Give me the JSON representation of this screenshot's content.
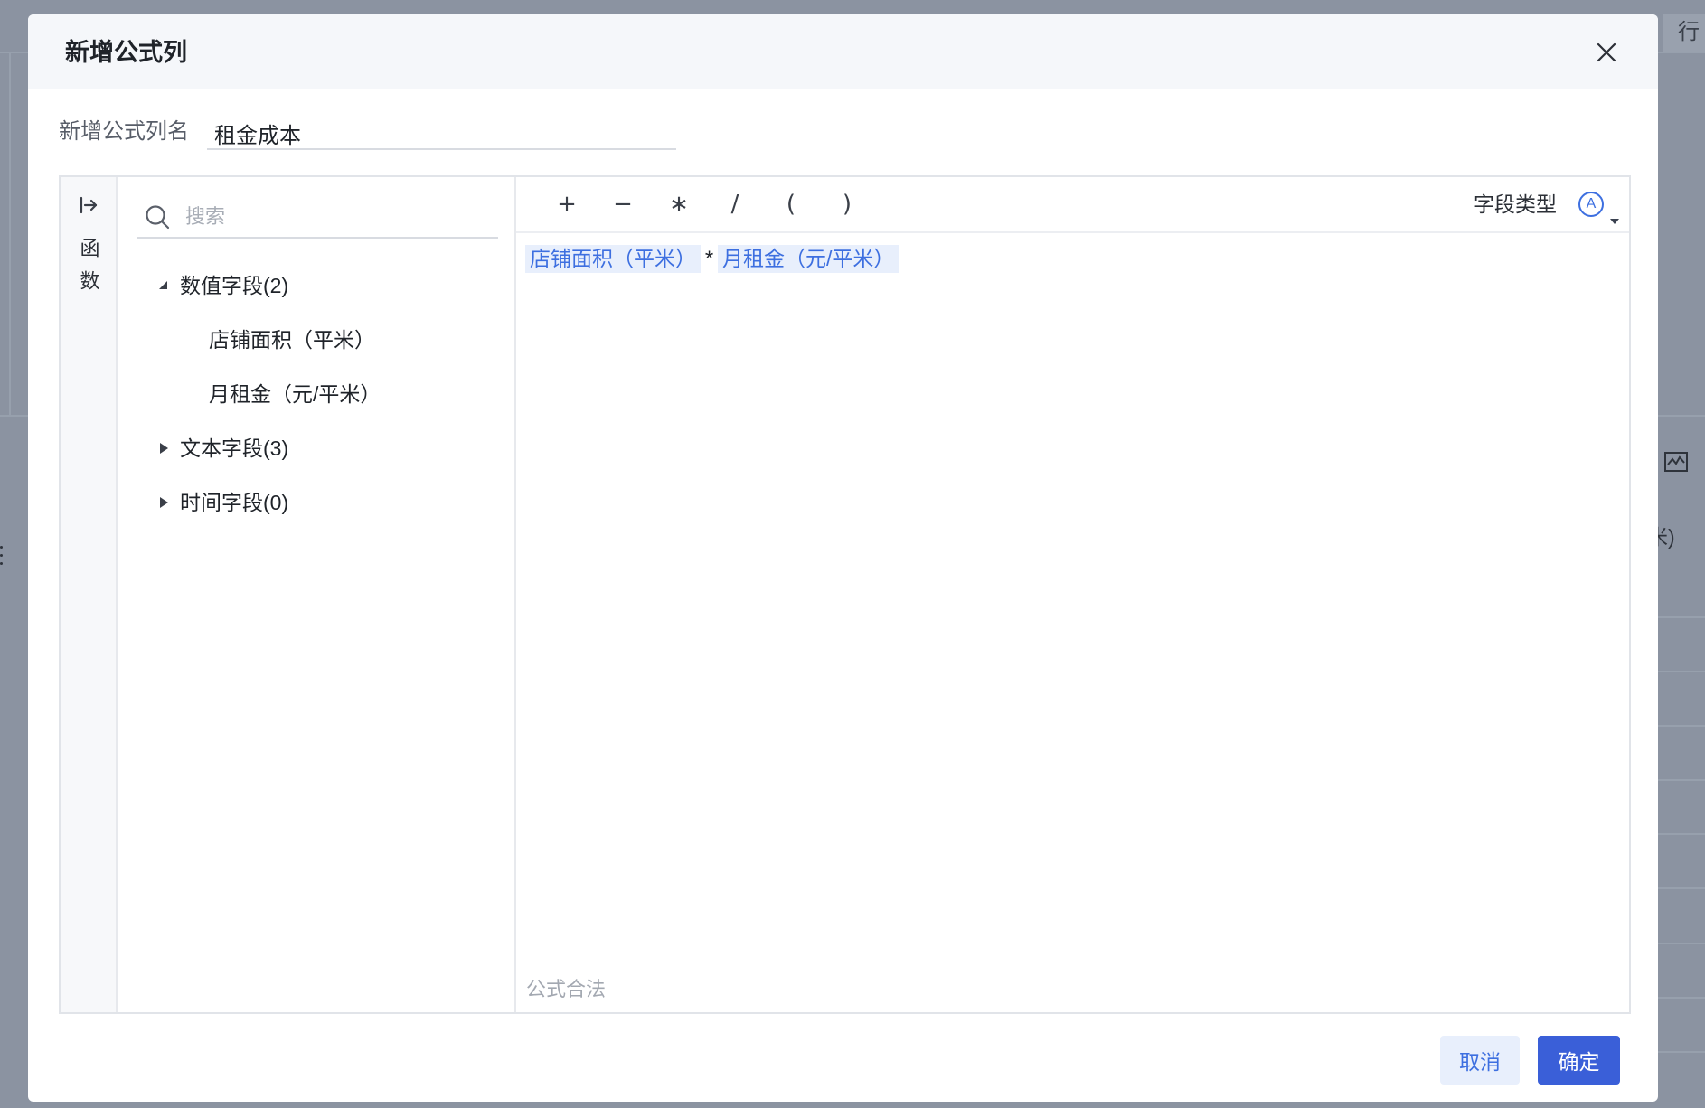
{
  "background": {
    "column_header": "行",
    "cell_fragment": "米)"
  },
  "dialog": {
    "title": "新增公式列"
  },
  "name_field": {
    "label": "新增公式列名",
    "value": "租金成本"
  },
  "function_tab": {
    "label": "函数"
  },
  "field_panel": {
    "search_placeholder": "搜索",
    "groups": [
      {
        "label": "数值字段(2)",
        "expanded": true,
        "items": [
          "店铺面积（平米）",
          "月租金（元/平米）"
        ]
      },
      {
        "label": "文本字段(3)",
        "expanded": false,
        "items": []
      },
      {
        "label": "时间字段(0)",
        "expanded": false,
        "items": []
      }
    ]
  },
  "editor": {
    "operators": [
      "+",
      "−",
      "∗",
      "/",
      "(",
      ")"
    ],
    "field_type": {
      "label": "字段类型",
      "badge": "A"
    },
    "formula": [
      "店铺面积（平米）",
      "*",
      "月租金（元/平米）"
    ],
    "status": "公式合法"
  },
  "footer": {
    "cancel_label": "取消",
    "confirm_label": "确定"
  },
  "icons": {
    "close": "close-icon",
    "panel_toggle": "expand-right-icon",
    "search": "search-icon",
    "tree_caret": "caret-icon",
    "field_type": "letter-a-circle-icon",
    "dropdown": "caret-down-icon",
    "background_chart": "chart-icon",
    "background_more": "more-vertical-icon"
  },
  "colors": {
    "overlay": "#8b93a1",
    "accent": "#3d6fe0",
    "primary": "#3a5fd8",
    "chip": "#e8effc",
    "header": "#f5f7fa",
    "text": "#1f2329",
    "muted": "#a3a8b1",
    "border": "#e1e4e9"
  }
}
